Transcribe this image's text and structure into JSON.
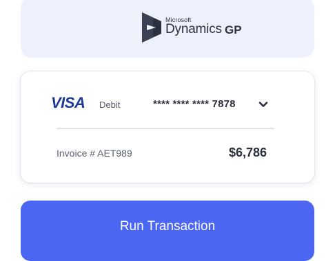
{
  "logo": {
    "company": "Microsoft",
    "product": "Dynamics",
    "suffix": "GP",
    "icon": "dynamics-logo-icon"
  },
  "payment": {
    "card_brand": "VISA",
    "card_type": "Debit",
    "card_number": "**** **** **** 7878",
    "dropdown_icon": "chevron-down-icon",
    "invoice_label": "Invoice # AET989",
    "amount": "$6,786"
  },
  "action": {
    "run_label": "Run Transaction"
  },
  "colors": {
    "accent": "#4a66f3",
    "visa_blue": "#1f3a93",
    "logo_dark": "#2c3140",
    "logo_card_bg": "#eef1fb"
  }
}
